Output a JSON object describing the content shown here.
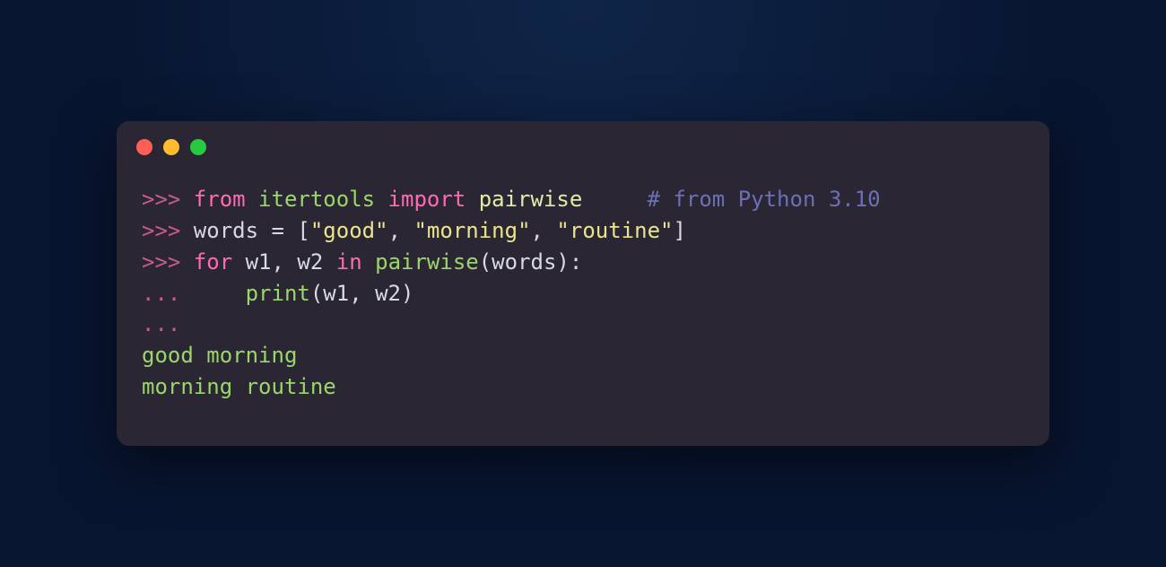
{
  "tokens": [
    [
      {
        "cls": "prompt",
        "t": ">>> "
      },
      {
        "cls": "keyword",
        "t": "from"
      },
      {
        "cls": "default",
        "t": " "
      },
      {
        "cls": "module",
        "t": "itertools"
      },
      {
        "cls": "default",
        "t": " "
      },
      {
        "cls": "kwimport",
        "t": "import"
      },
      {
        "cls": "default",
        "t": " "
      },
      {
        "cls": "name",
        "t": "pairwise"
      },
      {
        "cls": "default",
        "t": "     "
      },
      {
        "cls": "comment",
        "t": "# from Python 3.10"
      }
    ],
    [
      {
        "cls": "prompt",
        "t": ">>> "
      },
      {
        "cls": "default",
        "t": "words "
      },
      {
        "cls": "punc",
        "t": "="
      },
      {
        "cls": "default",
        "t": " "
      },
      {
        "cls": "punc",
        "t": "["
      },
      {
        "cls": "string",
        "t": "\"good\""
      },
      {
        "cls": "punc",
        "t": ", "
      },
      {
        "cls": "string",
        "t": "\"morning\""
      },
      {
        "cls": "punc",
        "t": ", "
      },
      {
        "cls": "string",
        "t": "\"routine\""
      },
      {
        "cls": "punc",
        "t": "]"
      }
    ],
    [
      {
        "cls": "prompt",
        "t": ">>> "
      },
      {
        "cls": "for",
        "t": "for"
      },
      {
        "cls": "default",
        "t": " w1"
      },
      {
        "cls": "punc",
        "t": ","
      },
      {
        "cls": "default",
        "t": " w2 "
      },
      {
        "cls": "in",
        "t": "in"
      },
      {
        "cls": "default",
        "t": " "
      },
      {
        "cls": "call",
        "t": "pairwise"
      },
      {
        "cls": "punc",
        "t": "("
      },
      {
        "cls": "default",
        "t": "words"
      },
      {
        "cls": "punc",
        "t": "):"
      }
    ],
    [
      {
        "cls": "prompt",
        "t": "... "
      },
      {
        "cls": "default",
        "t": "    "
      },
      {
        "cls": "call",
        "t": "print"
      },
      {
        "cls": "punc",
        "t": "("
      },
      {
        "cls": "default",
        "t": "w1"
      },
      {
        "cls": "punc",
        "t": ","
      },
      {
        "cls": "default",
        "t": " w2"
      },
      {
        "cls": "punc",
        "t": ")"
      }
    ],
    [
      {
        "cls": "prompt",
        "t": "..."
      }
    ],
    [
      {
        "cls": "output",
        "t": "good morning"
      }
    ],
    [
      {
        "cls": "output",
        "t": "morning routine"
      }
    ]
  ]
}
